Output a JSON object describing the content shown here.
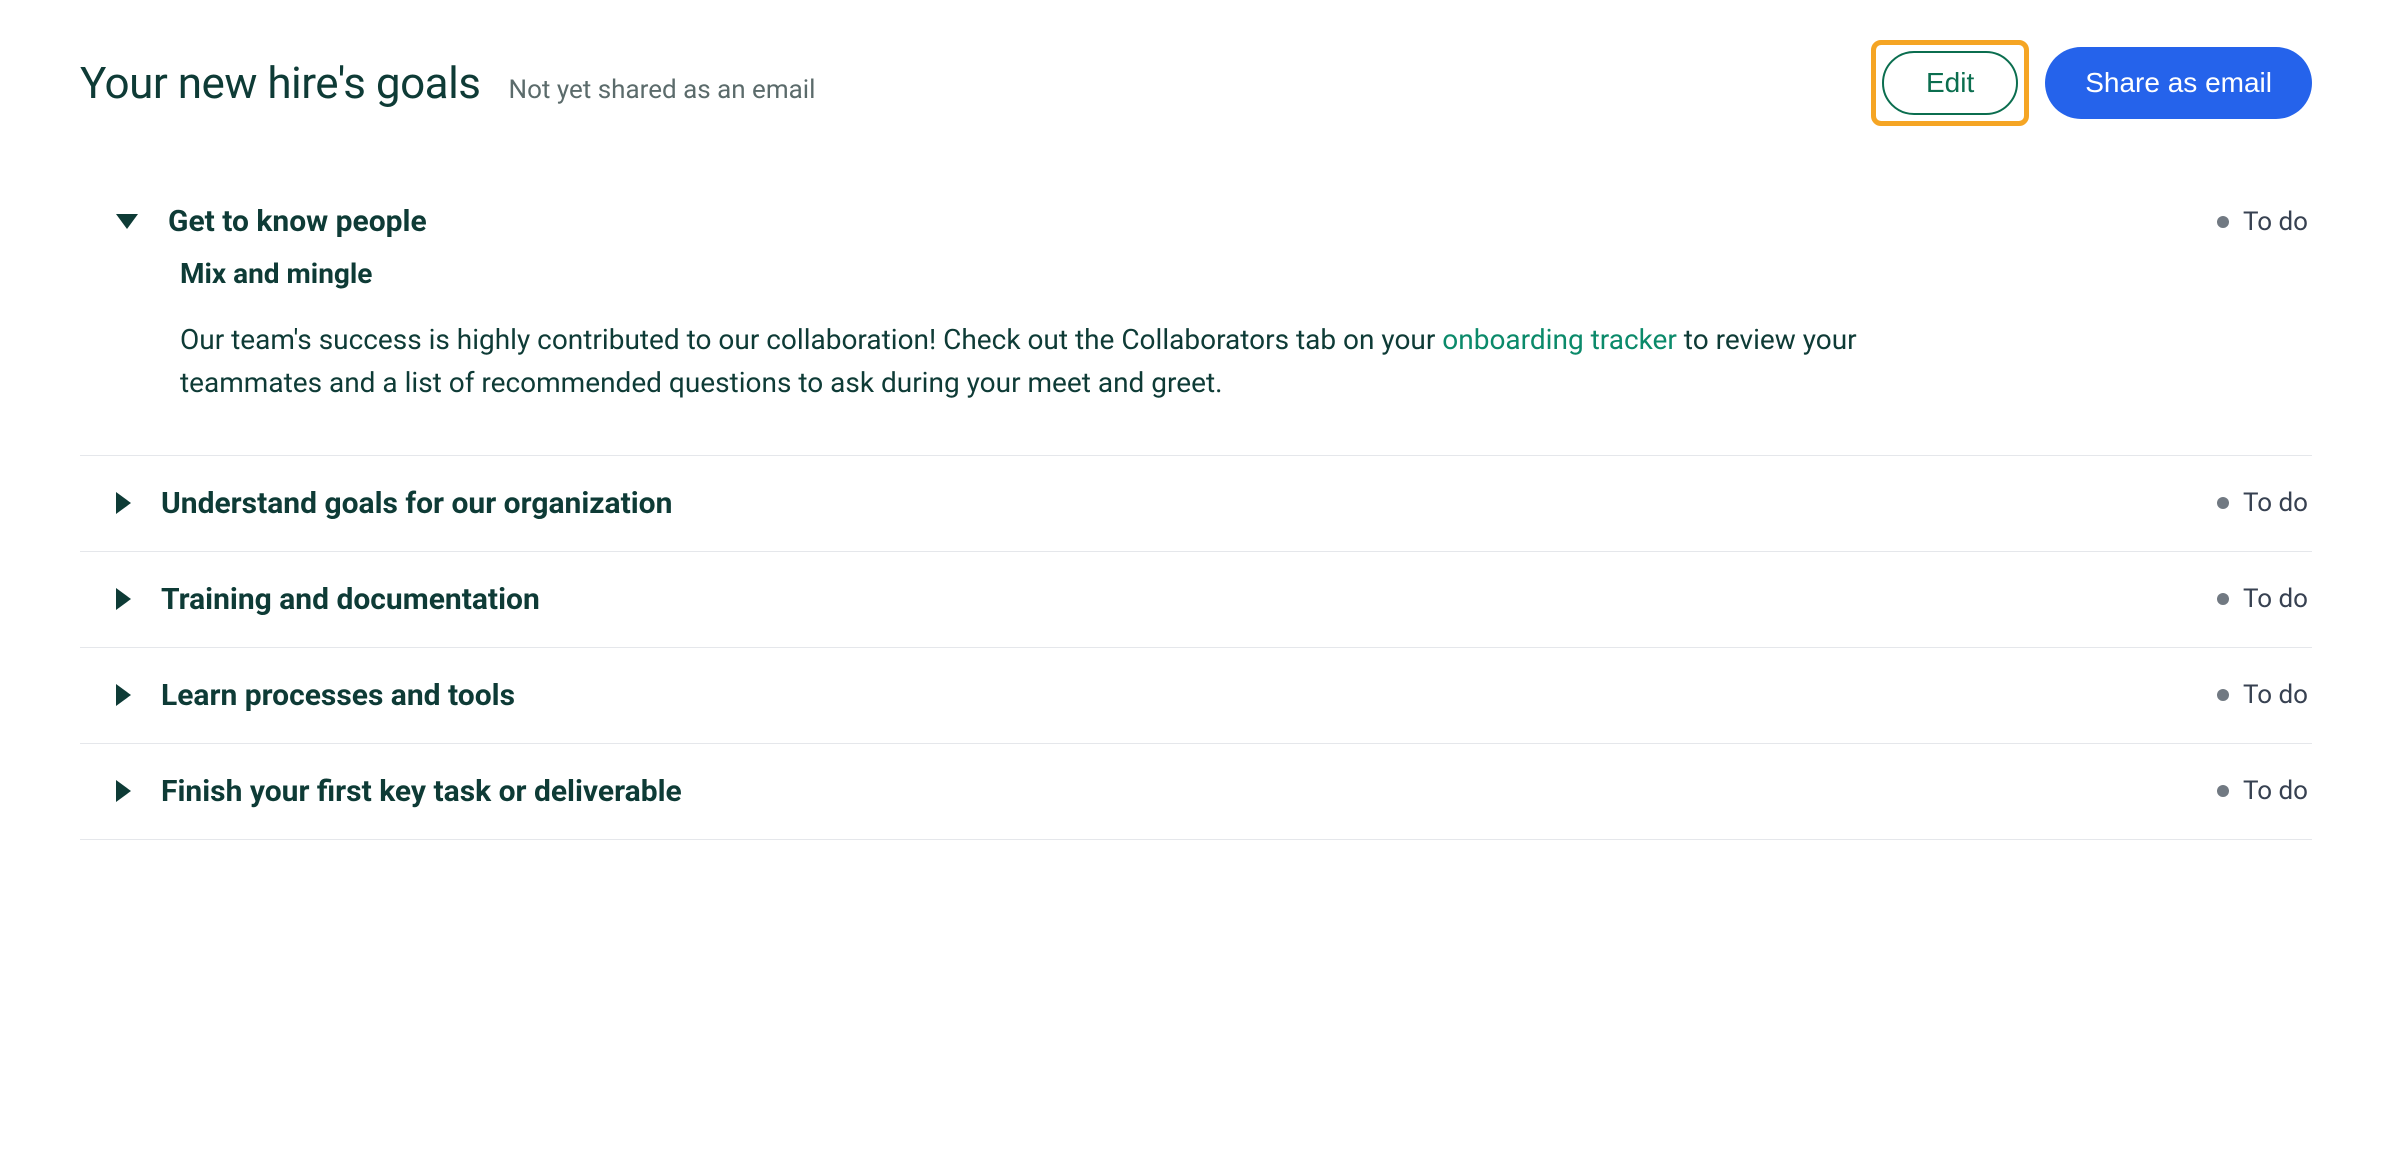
{
  "header": {
    "title": "Your new hire's goals",
    "subtitle": "Not yet shared as an email",
    "edit_label": "Edit",
    "share_label": "Share as email"
  },
  "goals": [
    {
      "title": "Get to know people",
      "status": "To do",
      "expanded": true,
      "sub": {
        "title": "Mix and mingle",
        "body_before": "Our team's success is highly contributed to our collaboration! Check out the Collaborators tab on your ",
        "link_text": "onboarding tracker",
        "body_after": " to review your teammates and a list of recommended questions to ask during your meet and greet."
      }
    },
    {
      "title": "Understand goals for our organization",
      "status": "To do",
      "expanded": false
    },
    {
      "title": "Training and documentation",
      "status": "To do",
      "expanded": false
    },
    {
      "title": "Learn processes and tools",
      "status": "To do",
      "expanded": false
    },
    {
      "title": "Finish your first key task or deliverable",
      "status": "To do",
      "expanded": false
    }
  ]
}
